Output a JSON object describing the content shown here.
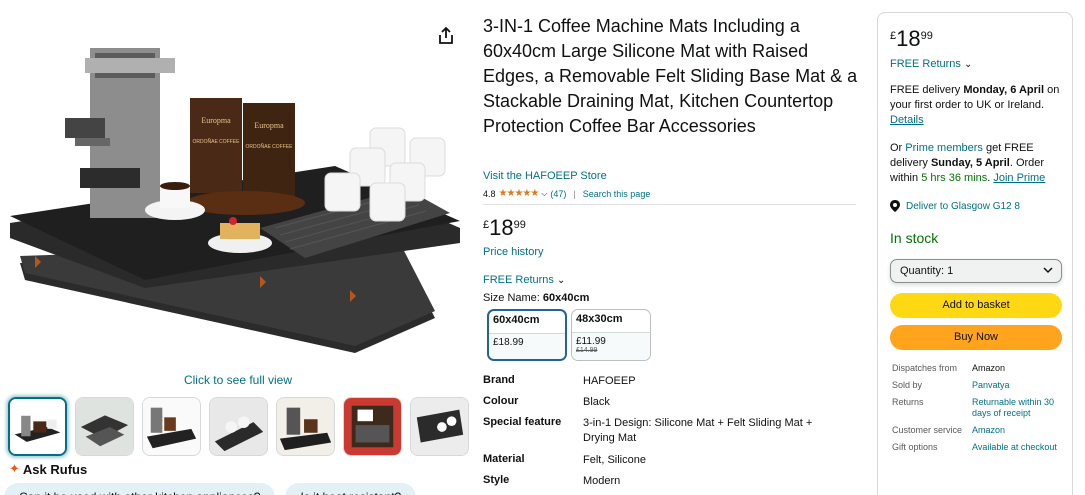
{
  "gallery": {
    "click_to_see": "Click to see full view",
    "ask_rufus": "Ask Rufus",
    "chips": [
      "Can it be used with other kitchen appliances?",
      "Is it heat resistant?"
    ],
    "packaging_text": [
      "Europma",
      "ORDOÑAE COFFEE",
      "Europma",
      "ORDOÑAE COFFEE"
    ],
    "thumb_count": 7,
    "active_thumb": 0
  },
  "product": {
    "title": "3-IN-1 Coffee Machine Mats Including a 60x40cm Large Silicone Mat with Raised Edges, a Removable Felt Sliding Base Mat & a Stackable Draining Mat, Kitchen Countertop Protection Coffee Bar Accessories",
    "store_link": "Visit the HAFOEEP Store",
    "rating": "4.8",
    "stars": "★★★★★",
    "review_count": "(47)",
    "search_page": "Search this page",
    "price": {
      "currency": "£",
      "whole": "18",
      "fraction": "99"
    },
    "price_history": "Price history",
    "returns": "FREE Returns",
    "size_label": "Size Name:",
    "size_value": "60x40cm",
    "sizes": [
      {
        "name": "60x40cm",
        "price": "£18.99",
        "was": ""
      },
      {
        "name": "48x30cm",
        "price": "£11.99",
        "was": "£14.99"
      }
    ],
    "specs": [
      {
        "key": "Brand",
        "value": "HAFOEEP"
      },
      {
        "key": "Colour",
        "value": "Black"
      },
      {
        "key": "Special feature",
        "value": "3-in-1 Design: Silicone Mat + Felt Sliding Mat + Drying Mat"
      },
      {
        "key": "Material",
        "value": "Felt, Silicone"
      },
      {
        "key": "Style",
        "value": "Modern"
      }
    ]
  },
  "buybox": {
    "price": {
      "currency": "£",
      "whole": "18",
      "fraction": "99"
    },
    "returns": "FREE Returns",
    "delivery_prefix": "FREE delivery ",
    "delivery_date": "Monday, 6 April",
    "delivery_suffix": " on your first order to UK or Ireland.",
    "details_link": "Details",
    "prime_prefix": "Or ",
    "prime_link": "Prime members",
    "prime_mid": " get FREE delivery ",
    "prime_date": "Sunday, 5 April",
    "prime_mid2": ". Order within ",
    "prime_time": "5 hrs 36 mins",
    "prime_join": "Join Prime",
    "deliver_to": "Deliver to Glasgow G12 8",
    "stock": "In stock",
    "quantity": "Quantity: 1",
    "add_to_basket": "Add to basket",
    "buy_now": "Buy Now",
    "info": [
      {
        "key": "Dispatches from",
        "value": "Amazon"
      },
      {
        "key": "Sold by",
        "value": "Panvatya"
      },
      {
        "key": "Returns",
        "value": "Returnable within 30 days of receipt"
      },
      {
        "key": "Customer service",
        "value": "Amazon"
      },
      {
        "key": "Gift options",
        "value": "Available at checkout"
      }
    ]
  },
  "colors": {
    "link": "#007185",
    "star": "#de7921",
    "stock": "#007600",
    "basket": "#ffd814",
    "buy_now": "#ffa41c",
    "selected_size": "#2162a1"
  }
}
